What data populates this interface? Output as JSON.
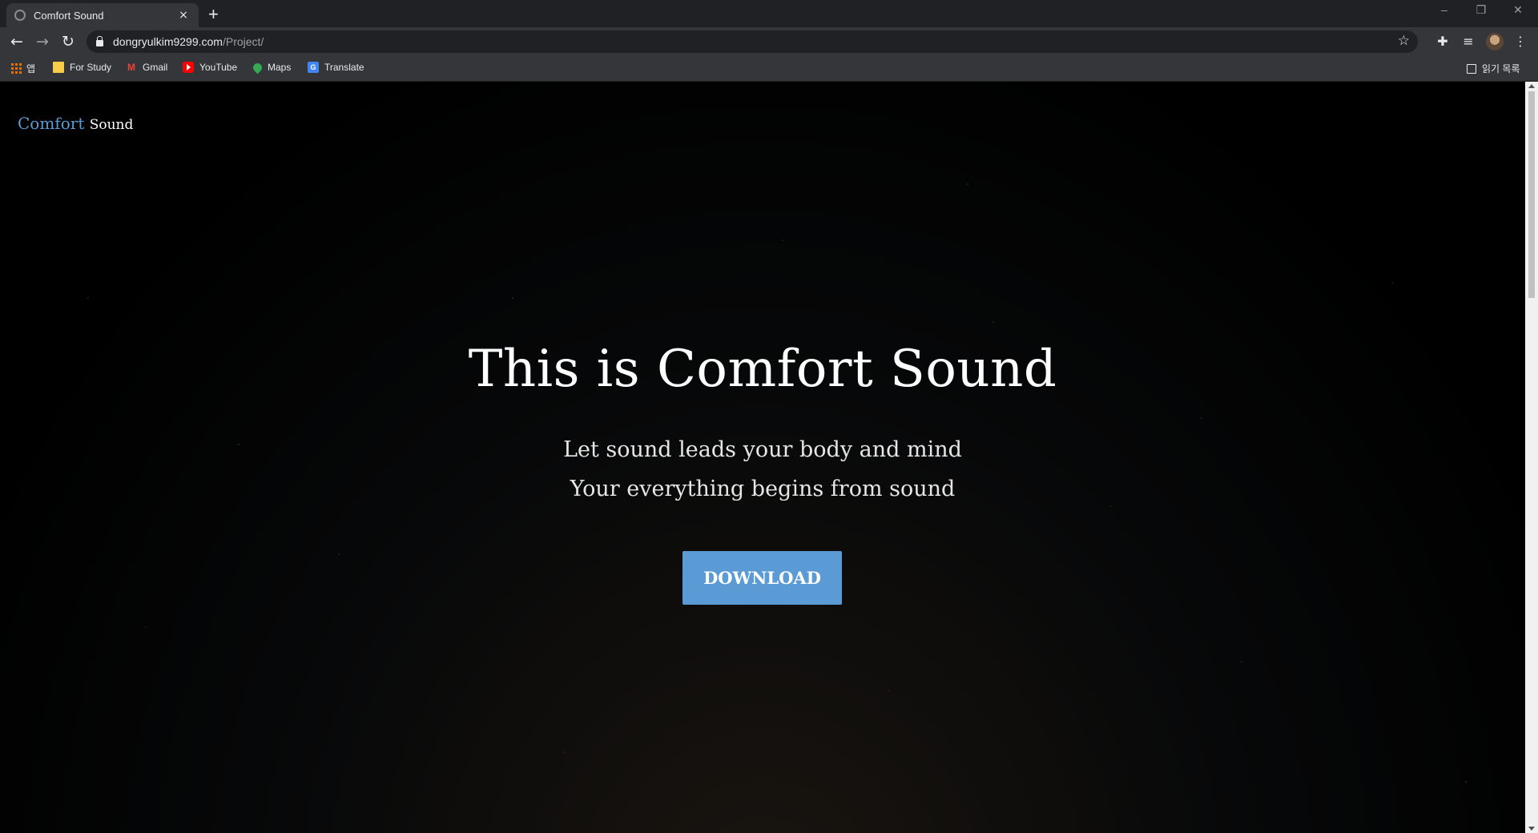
{
  "browser": {
    "tab_title": "Comfort Sound",
    "tab_close": "×",
    "new_tab": "+",
    "url_host": "dongryulkim9299.com",
    "url_path": "/Project/",
    "window_controls": {
      "minimize": "–",
      "restore": "❐",
      "close": "✕"
    },
    "nav": {
      "back": "←",
      "forward": "→",
      "reload": "↻"
    },
    "toolbar_icons": {
      "star": "☆",
      "extensions": "✚",
      "media": "≡",
      "menu": "⋮"
    },
    "bookmarks": {
      "apps_label": "앱",
      "items": [
        {
          "label": "For Study",
          "icon": "folder-icon"
        },
        {
          "label": "Gmail",
          "icon": "gmail-icon"
        },
        {
          "label": "YouTube",
          "icon": "youtube-icon"
        },
        {
          "label": "Maps",
          "icon": "maps-icon"
        },
        {
          "label": "Translate",
          "icon": "translate-icon"
        }
      ],
      "reading_list": "읽기 목록"
    }
  },
  "page": {
    "brand_first": "Comfort",
    "brand_second": "Sound",
    "hero_title": "This is Comfort Sound",
    "subtitle_line1": "Let sound leads your body and mind",
    "subtitle_line2": "Your everything begins from sound",
    "download_label": "DOWNLOAD"
  },
  "colors": {
    "accent": "#5b9bd5",
    "background": "#000000",
    "chrome_dark": "#202124",
    "chrome": "#35363a"
  }
}
